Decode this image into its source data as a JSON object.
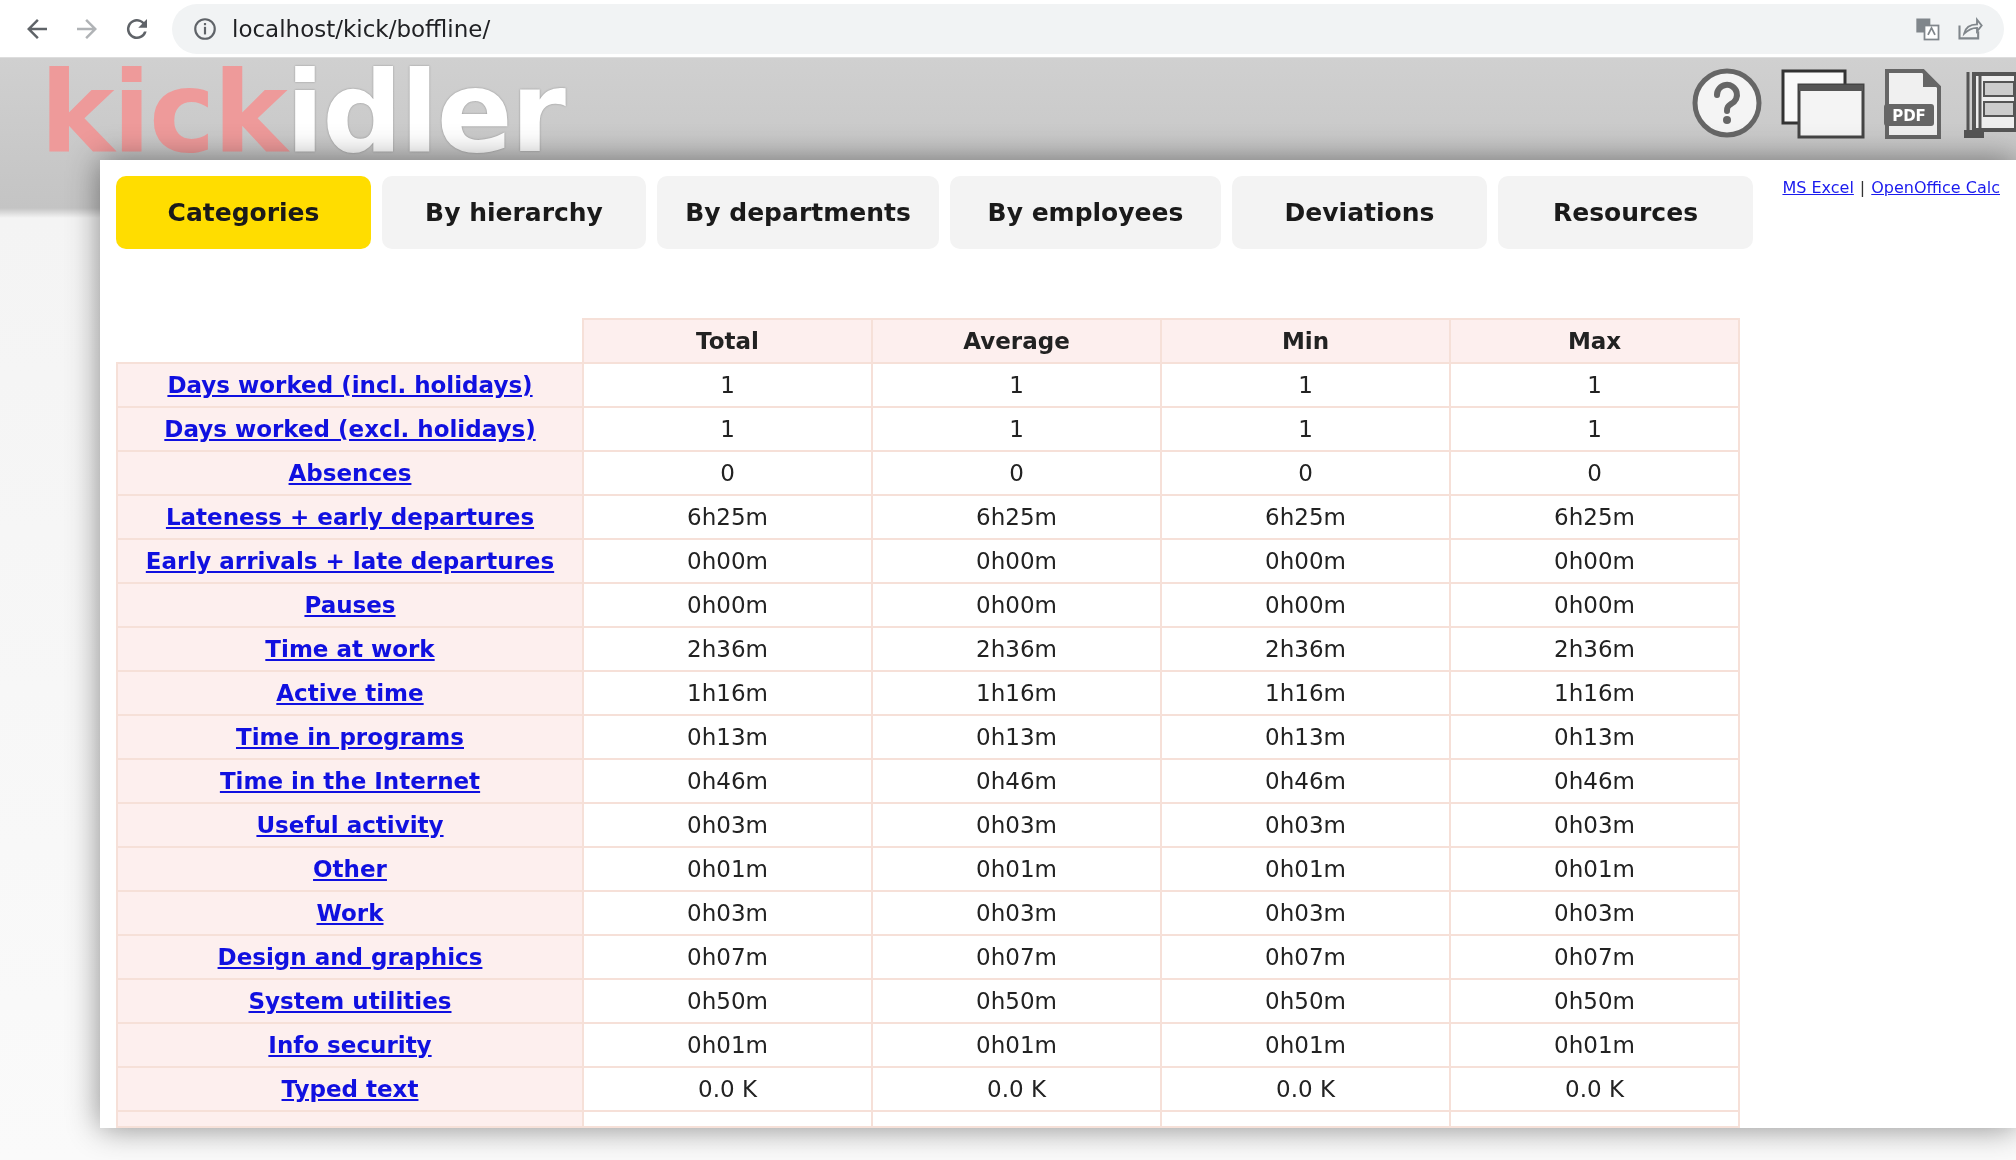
{
  "browser": {
    "url": "localhost/kick/boffline/"
  },
  "logo": {
    "prefix": "kick",
    "suffix": "idler"
  },
  "tabs": [
    {
      "label": "Categories",
      "selected": true
    },
    {
      "label": "By hierarchy",
      "selected": false
    },
    {
      "label": "By departments",
      "selected": false
    },
    {
      "label": "By employees",
      "selected": false
    },
    {
      "label": "Deviations",
      "selected": false
    },
    {
      "label": "Resources",
      "selected": false
    }
  ],
  "pdf_badge": "PDF",
  "export_links": [
    "MS Excel",
    "OpenOffice Calc"
  ],
  "export_separator": "|",
  "table": {
    "columns": [
      "Total",
      "Average",
      "Min",
      "Max"
    ],
    "rows": [
      {
        "label": "Days worked (incl. holidays)",
        "values": [
          "1",
          "1",
          "1",
          "1"
        ]
      },
      {
        "label": "Days worked (excl. holidays)",
        "values": [
          "1",
          "1",
          "1",
          "1"
        ]
      },
      {
        "label": "Absences",
        "values": [
          "0",
          "0",
          "0",
          "0"
        ]
      },
      {
        "label": "Lateness + early departures",
        "values": [
          "6h25m",
          "6h25m",
          "6h25m",
          "6h25m"
        ]
      },
      {
        "label": "Early arrivals + late departures",
        "values": [
          "0h00m",
          "0h00m",
          "0h00m",
          "0h00m"
        ]
      },
      {
        "label": "Pauses",
        "values": [
          "0h00m",
          "0h00m",
          "0h00m",
          "0h00m"
        ]
      },
      {
        "label": "Time at work",
        "values": [
          "2h36m",
          "2h36m",
          "2h36m",
          "2h36m"
        ]
      },
      {
        "label": "Active time",
        "values": [
          "1h16m",
          "1h16m",
          "1h16m",
          "1h16m"
        ]
      },
      {
        "label": "Time in programs",
        "values": [
          "0h13m",
          "0h13m",
          "0h13m",
          "0h13m"
        ]
      },
      {
        "label": "Time in the Internet",
        "values": [
          "0h46m",
          "0h46m",
          "0h46m",
          "0h46m"
        ]
      },
      {
        "label": "Useful activity",
        "values": [
          "0h03m",
          "0h03m",
          "0h03m",
          "0h03m"
        ]
      },
      {
        "label": "Other",
        "values": [
          "0h01m",
          "0h01m",
          "0h01m",
          "0h01m"
        ]
      },
      {
        "label": "Work",
        "values": [
          "0h03m",
          "0h03m",
          "0h03m",
          "0h03m"
        ]
      },
      {
        "label": "Design and graphics",
        "values": [
          "0h07m",
          "0h07m",
          "0h07m",
          "0h07m"
        ]
      },
      {
        "label": "System utilities",
        "values": [
          "0h50m",
          "0h50m",
          "0h50m",
          "0h50m"
        ]
      },
      {
        "label": "Info security",
        "values": [
          "0h01m",
          "0h01m",
          "0h01m",
          "0h01m"
        ]
      },
      {
        "label": "Typed text",
        "values": [
          "0.0 K",
          "0.0 K",
          "0.0 K",
          "0.0 K"
        ]
      }
    ]
  }
}
